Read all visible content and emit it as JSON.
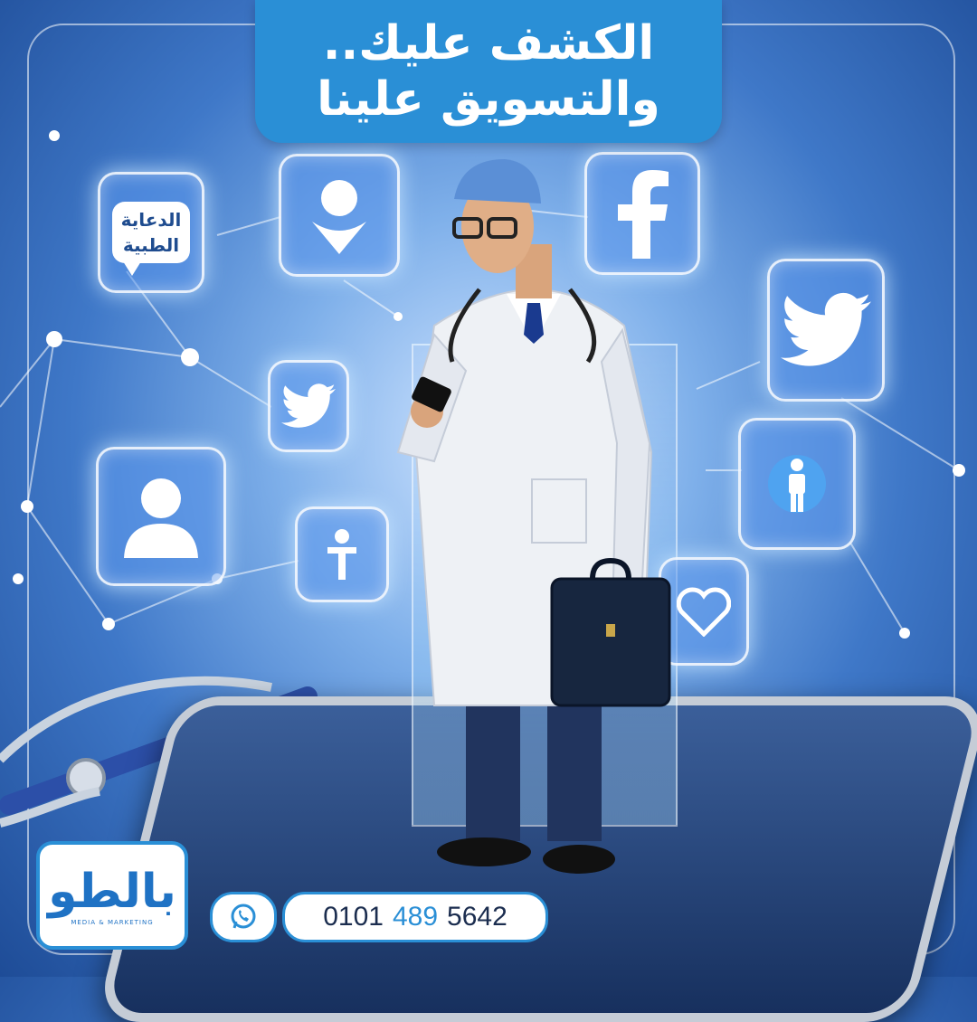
{
  "headline": {
    "line1": "الكشف عليك..",
    "line2": "والتسويق علينا"
  },
  "bubble": {
    "line1": "الدعاية",
    "line2": "الطبية"
  },
  "icons": {
    "top_left_pin": "location-pin-icon",
    "facebook": "facebook-icon",
    "twitter_large": "twitter-icon",
    "twitter_small": "twitter-icon",
    "user": "user-icon",
    "person": "person-icon",
    "heart": "heart-icon",
    "whatsapp": "whatsapp-icon"
  },
  "logo": {
    "mark": "بالطو",
    "subtitle": "MEDIA & MARKETING"
  },
  "contact": {
    "part1": "0101",
    "part2": "489",
    "part3": "5642"
  },
  "colors": {
    "accent": "#2a8fd6",
    "background": "#3f78c8"
  }
}
